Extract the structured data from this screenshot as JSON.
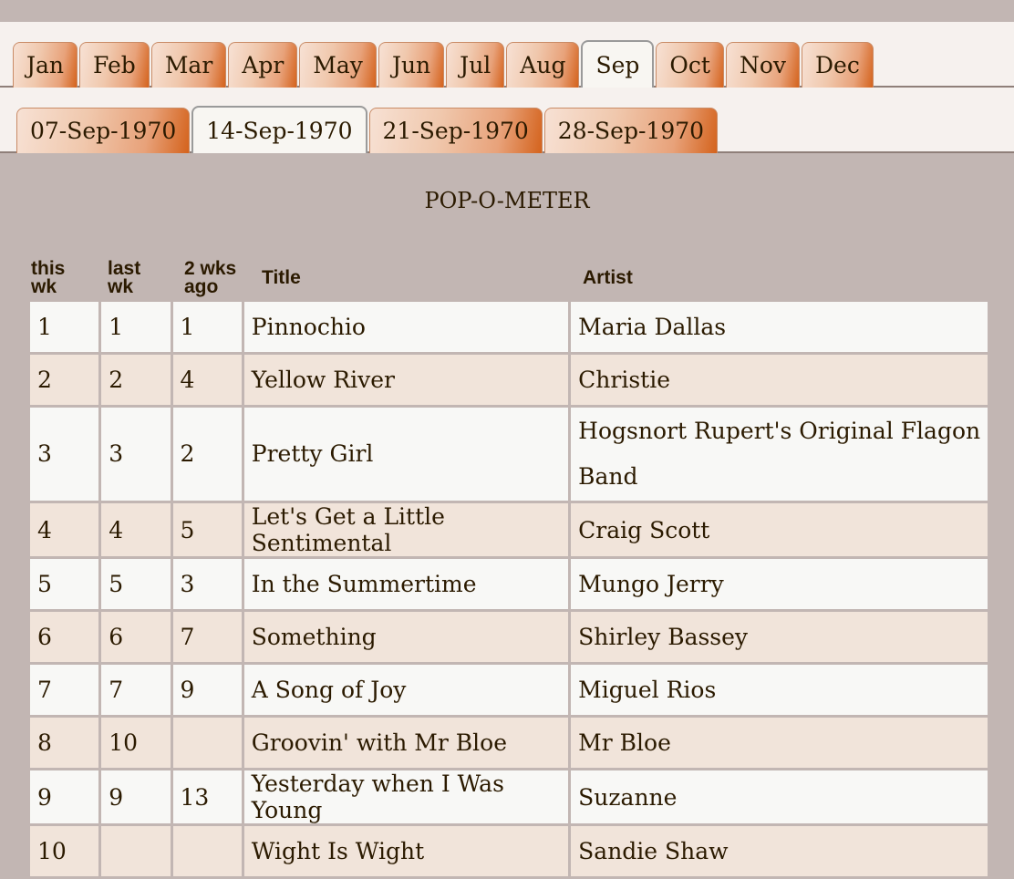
{
  "months": [
    "Jan",
    "Feb",
    "Mar",
    "Apr",
    "May",
    "Jun",
    "Jul",
    "Aug",
    "Sep",
    "Oct",
    "Nov",
    "Dec"
  ],
  "active_month": "Sep",
  "weeks": [
    "07-Sep-1970",
    "14-Sep-1970",
    "21-Sep-1970",
    "28-Sep-1970"
  ],
  "active_week": "14-Sep-1970",
  "chart_title": "POP-O-METER",
  "columns": {
    "this_wk": "this wk",
    "last_wk": "last wk",
    "two_wks": "2 wks ago",
    "title": "Title",
    "artist": "Artist"
  },
  "rows": [
    {
      "this": "1",
      "last": "1",
      "two": "1",
      "title": "Pinnochio",
      "artist": "Maria Dallas"
    },
    {
      "this": "2",
      "last": "2",
      "two": "4",
      "title": "Yellow River",
      "artist": "Christie"
    },
    {
      "this": "3",
      "last": "3",
      "two": "2",
      "title": "Pretty Girl",
      "artist": "Hogsnort Rupert's Original Flagon Band"
    },
    {
      "this": "4",
      "last": "4",
      "two": "5",
      "title": "Let's Get a Little Sentimental",
      "artist": "Craig Scott"
    },
    {
      "this": "5",
      "last": "5",
      "two": "3",
      "title": "In the Summertime",
      "artist": "Mungo Jerry"
    },
    {
      "this": "6",
      "last": "6",
      "two": "7",
      "title": "Something",
      "artist": "Shirley Bassey"
    },
    {
      "this": "7",
      "last": "7",
      "two": "9",
      "title": "A Song of Joy",
      "artist": "Miguel Rios"
    },
    {
      "this": "8",
      "last": "10",
      "two": "",
      "title": "Groovin' with Mr Bloe",
      "artist": "Mr Bloe"
    },
    {
      "this": "9",
      "last": "9",
      "two": "13",
      "title": "Yesterday when I Was Young",
      "artist": "Suzanne"
    },
    {
      "this": "10",
      "last": "",
      "two": "",
      "title": "Wight Is Wight",
      "artist": "Sandie Shaw"
    }
  ]
}
